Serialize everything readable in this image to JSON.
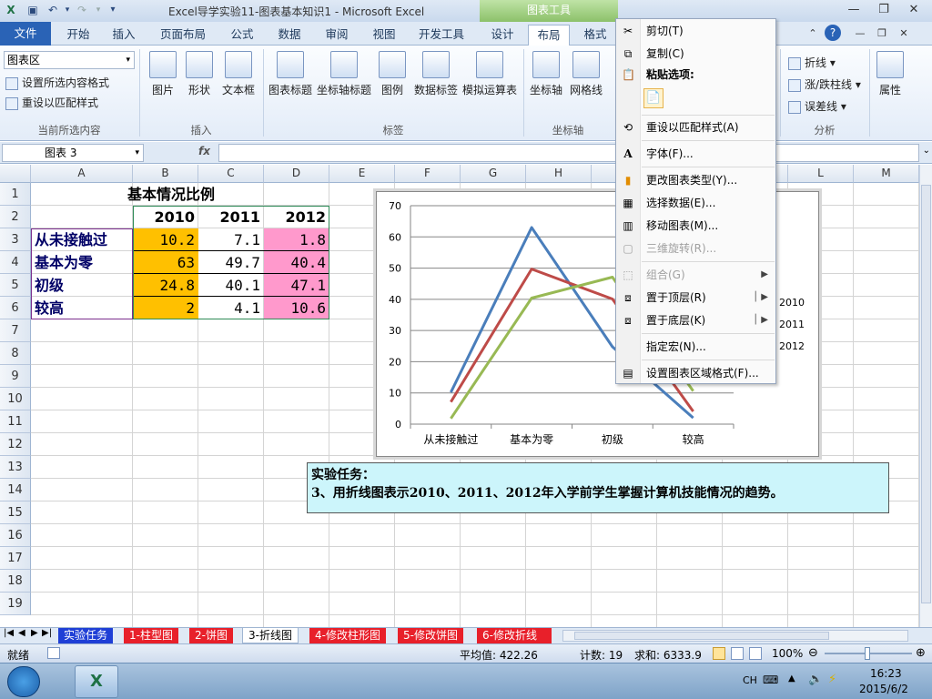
{
  "window": {
    "title": "Excel导学实验11-图表基本知识1  -  Microsoft Excel",
    "chart_tools_label": "图表工具"
  },
  "ribbon_tabs": [
    "文件",
    "开始",
    "插入",
    "页面布局",
    "公式",
    "数据",
    "审阅",
    "视图",
    "开发工具",
    "设计",
    "布局",
    "格式"
  ],
  "ribbon": {
    "selection_dropdown": "图表区",
    "format_selection": "设置所选内容格式",
    "reset_to_match": "重设以匹配样式",
    "group_current_selection": "当前所选内容",
    "insert_buttons": [
      "图片",
      "形状",
      "文本框"
    ],
    "group_insert": "插入",
    "label_buttons": [
      "图表标题",
      "坐标轴标题",
      "图例",
      "数据标签",
      "模拟运算表"
    ],
    "group_labels": "标签",
    "axes_buttons": [
      "坐标轴",
      "网格线"
    ],
    "group_axes": "坐标轴",
    "analysis_items": [
      "折线",
      "涨/跌柱线",
      "误差线"
    ],
    "group_analysis": "分析",
    "properties": "属性"
  },
  "formula_bar": {
    "name_box": "图表 3",
    "fx": "fx"
  },
  "columns": [
    "A",
    "B",
    "C",
    "D",
    "E",
    "F",
    "G",
    "H",
    "I",
    "J",
    "K",
    "L",
    "M"
  ],
  "rows": [
    "1",
    "2",
    "3",
    "4",
    "5",
    "6",
    "7",
    "8",
    "9",
    "10",
    "11",
    "12",
    "13",
    "14",
    "15",
    "16",
    "17",
    "18",
    "19"
  ],
  "table": {
    "title": "基本情况比例",
    "years": [
      "2010",
      "2011",
      "2012"
    ],
    "rows": [
      {
        "label": "从未接触过",
        "v2010": "10.2",
        "v2011": "7.1",
        "v2012": "1.8"
      },
      {
        "label": "基本为零",
        "v2010": "63",
        "v2011": "49.7",
        "v2012": "40.4"
      },
      {
        "label": "初级",
        "v2010": "24.8",
        "v2011": "40.1",
        "v2012": "47.1"
      },
      {
        "label": "较高",
        "v2010": "2",
        "v2011": "4.1",
        "v2012": "10.6"
      }
    ]
  },
  "chart_data": {
    "type": "line",
    "categories": [
      "从未接触过",
      "基本为零",
      "初级",
      "较高"
    ],
    "series": [
      {
        "name": "2010",
        "values": [
          10.2,
          63,
          24.8,
          2
        ],
        "color": "#4a7ebb"
      },
      {
        "name": "2011",
        "values": [
          7.1,
          49.7,
          40.1,
          4.1
        ],
        "color": "#be4b48"
      },
      {
        "name": "2012",
        "values": [
          1.8,
          40.4,
          47.1,
          10.6
        ],
        "color": "#98b954"
      }
    ],
    "yticks": [
      "0",
      "10",
      "20",
      "30",
      "40",
      "50",
      "60",
      "70"
    ],
    "ylim": [
      0,
      70
    ],
    "grid": true,
    "legend": "right"
  },
  "task_note": {
    "line1": "实验任务：",
    "line2": "3、用折线图表示2010、2011、2012年入学前学生掌握计算机技能情况的趋势。"
  },
  "context_menu": {
    "cut": "剪切(T)",
    "copy": "复制(C)",
    "paste_options": "粘贴选项:",
    "reset_style": "重设以匹配样式(A)",
    "font": "字体(F)...",
    "change_chart_type": "更改图表类型(Y)...",
    "select_data": "选择数据(E)...",
    "move_chart": "移动图表(M)...",
    "rotate_3d": "三维旋转(R)...",
    "group": "组合(G)",
    "bring_to_front": "置于顶层(R)",
    "send_to_back": "置于底层(K)",
    "assign_macro": "指定宏(N)...",
    "format_chart_area": "设置图表区域格式(F)..."
  },
  "sheet_tabs": [
    "实验任务",
    "1-柱型图",
    "2-饼图",
    "3-折线图",
    "4-修改柱形图",
    "5-修改饼图",
    "6-修改折线"
  ],
  "status": {
    "ready": "就绪",
    "average": "平均值: 422.26",
    "count": "计数: 19",
    "sum": "求和: 6333.9",
    "zoom": "100%"
  },
  "taskbar": {
    "lang": "CH",
    "time": "16:23",
    "date": "2015/6/2"
  },
  "colors": {
    "orange": "#ffc000",
    "pink": "#ff99cc",
    "label_navy": "#000066",
    "note_bg": "#ccf5fb"
  }
}
